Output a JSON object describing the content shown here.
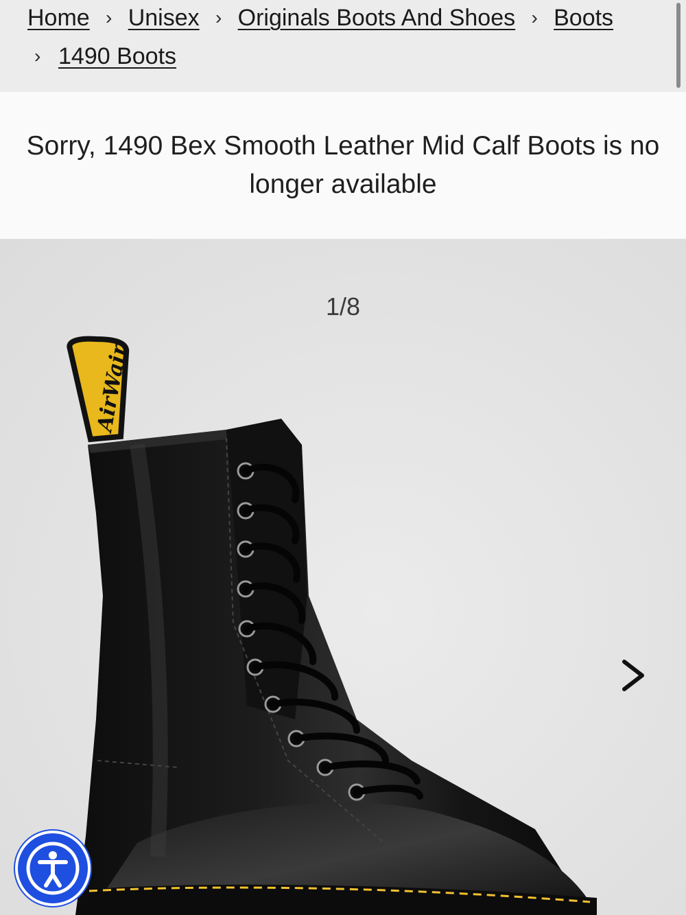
{
  "breadcrumb": {
    "items": [
      {
        "label": "Home"
      },
      {
        "label": "Unisex"
      },
      {
        "label": "Originals Boots And Shoes"
      },
      {
        "label": "Boots"
      },
      {
        "label": "1490 Boots"
      }
    ],
    "separator": "›"
  },
  "notice": {
    "message": "Sorry, 1490 Bex Smooth Leather Mid Calf Boots is no longer available"
  },
  "gallery": {
    "counter": "1/8",
    "next_icon": "chevron-right-icon",
    "heel_loop_text": "AirWair"
  },
  "accessibility": {
    "icon": "accessibility-icon"
  },
  "colors": {
    "breadcrumb_bg": "#ececec",
    "accessibility_blue": "#1f4fe0",
    "welt_stitch_yellow": "#f2c230"
  }
}
